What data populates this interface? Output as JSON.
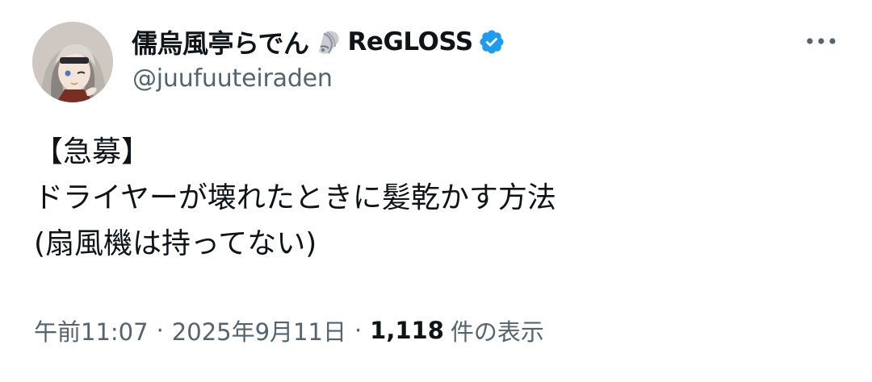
{
  "tweet": {
    "author": {
      "display_name": "儒烏風亭らでん",
      "emoji_icon": "shell-icon",
      "group": "ReGLOSS",
      "verified_icon": "verified-badge-icon",
      "handle": "@juufuuteiraden"
    },
    "more_icon": "more-icon",
    "body_lines": [
      "【急募】",
      "ドライヤーが壊れたときに髪乾かす方法",
      "(扇風機は持ってない)"
    ],
    "meta": {
      "time": "午前11:07",
      "separator": "·",
      "date": "2025年9月11日",
      "views_count": "1,118",
      "views_label": "件の表示"
    }
  },
  "colors": {
    "text_primary": "#0f1419",
    "text_secondary": "#536471",
    "verified_blue": "#1d9bf0",
    "background": "#ffffff"
  }
}
